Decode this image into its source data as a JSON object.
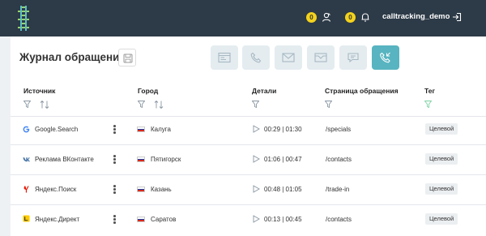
{
  "header": {
    "username": "calltracking_demo",
    "badge_1": "0",
    "badge_2": "0"
  },
  "page": {
    "title": "Журнал обращений"
  },
  "table": {
    "columns": [
      "Источник",
      "Город",
      "Детали",
      "Страница обращения",
      "Тег"
    ],
    "rows": [
      {
        "source": "Google.Search",
        "source_icon": "google-icon",
        "city": "Калуга",
        "time": "00:29 | 01:30",
        "page": "/specials",
        "tag": "Целевой"
      },
      {
        "source": "Реклама ВКонтакте",
        "source_icon": "vk-icon",
        "city": "Пятигорск",
        "time": "01:06 | 00:47",
        "page": "/contacts",
        "tag": "Целевой"
      },
      {
        "source": "Яндекс.Поиск",
        "source_icon": "yandex-icon",
        "city": "Казань",
        "time": "00:48 | 01:05",
        "page": "/trade-in",
        "tag": "Целевой"
      },
      {
        "source": "Яндекс.Директ",
        "source_icon": "yandex-direct-icon",
        "city": "Саратов",
        "time": "00:13 | 00:45",
        "page": "/contacts",
        "tag": "Целевой"
      }
    ]
  },
  "colors": {
    "topbar": "#2d3a47",
    "badge": "#f3d21c",
    "active_button": "#58b4c0",
    "toolbar_button": "#e4ecf0",
    "tag_filter": "#7ed2a4"
  }
}
